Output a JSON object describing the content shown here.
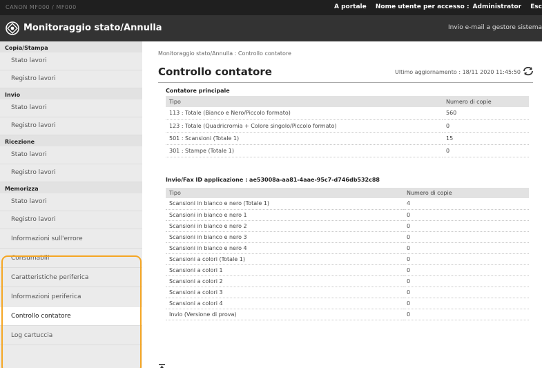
{
  "topbar": {
    "device_name": "CANON  MF000 / MF000",
    "portal": "A portale",
    "login_user_label": "Nome utente per accesso :",
    "login_user": "Administrator",
    "logout": "Esc"
  },
  "header": {
    "title": "Monitoraggio stato/Annulla",
    "email_link": "Invio e-mail a gestore sistema"
  },
  "sidebar": {
    "sections": [
      {
        "label": "Copia/Stampa",
        "items": [
          "Stato lavori",
          "Registro lavori"
        ]
      },
      {
        "label": "Invio",
        "items": [
          "Stato lavori",
          "Registro lavori"
        ]
      },
      {
        "label": "Ricezione",
        "items": [
          "Stato lavori",
          "Registro lavori"
        ]
      },
      {
        "label": "Memorizza",
        "items": [
          "Stato lavori",
          "Registro lavori"
        ]
      }
    ],
    "lower_items": [
      "Informazioni sull'errore",
      "Consumabili",
      "Caratteristiche periferica",
      "Informazioni periferica",
      "Controllo contatore",
      "Log cartuccia"
    ],
    "active_item": "Controllo contatore"
  },
  "main": {
    "breadcrumb": "Monitoraggio stato/Annulla : Controllo contatore",
    "title": "Controllo contatore",
    "last_update": "Ultimo aggiornamento : 18/11 2020 11:45:50",
    "main_counter": {
      "title": "Contatore principale",
      "columns": [
        "Tipo",
        "Numero di copie"
      ],
      "rows": [
        [
          "113 : Totale (Bianco e Nero/Piccolo formato)",
          "560"
        ],
        [
          "123 : Totale (Quadricromia + Colore singolo/Piccolo formato)",
          "0"
        ],
        [
          "501 : Scansioni (Totale 1)",
          "15"
        ],
        [
          "301 : Stampe (Totale 1)",
          "0"
        ]
      ]
    },
    "app_counter": {
      "title": "Invio/Fax ID applicazione : ae53008a-aa81-4aae-95c7-d746db532c88",
      "columns": [
        "Tipo",
        "Numero di copie"
      ],
      "rows": [
        [
          "Scansioni in bianco e nero (Totale 1)",
          "4"
        ],
        [
          "Scansioni in bianco e nero 1",
          "0"
        ],
        [
          "Scansioni in bianco e nero 2",
          "0"
        ],
        [
          "Scansioni in bianco e nero 3",
          "0"
        ],
        [
          "Scansioni in bianco e nero 4",
          "0"
        ],
        [
          "Scansioni a colori (Totale 1)",
          "0"
        ],
        [
          "Scansioni a colori 1",
          "0"
        ],
        [
          "Scansioni a colori 2",
          "0"
        ],
        [
          "Scansioni a colori 3",
          "0"
        ],
        [
          "Scansioni a colori 4",
          "0"
        ],
        [
          "Invio (Versione di prova)",
          "0"
        ]
      ]
    }
  },
  "colors": {
    "topbar": "#1f1f1f",
    "titlebar": "#333333",
    "sidebar": "#ebebeb",
    "highlight": "#f5a623"
  },
  "icons": {
    "logo": "monitor-status-icon",
    "refresh": "refresh-icon",
    "scroll_top": "scroll-top-icon"
  }
}
